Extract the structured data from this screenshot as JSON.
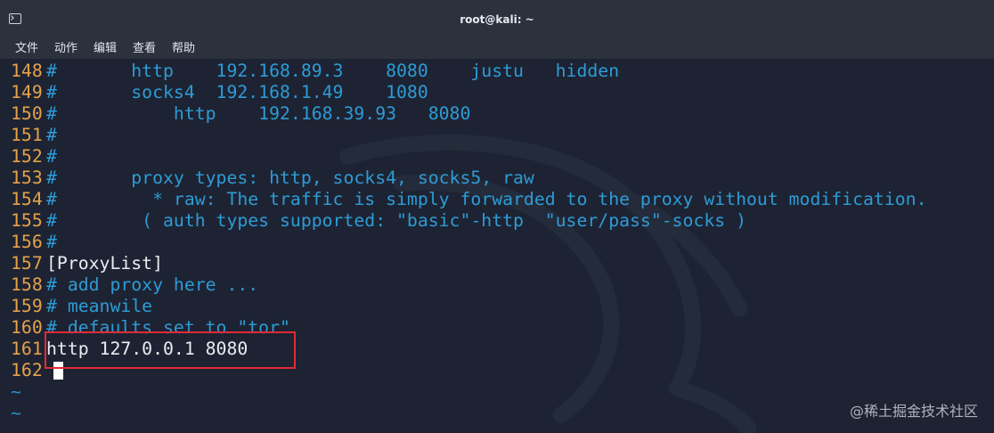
{
  "window": {
    "title": "root@kali: ~"
  },
  "menu": [
    {
      "label": "文件"
    },
    {
      "label": "动作"
    },
    {
      "label": "编辑"
    },
    {
      "label": "查看"
    },
    {
      "label": "帮助"
    }
  ],
  "lines": [
    {
      "num": "148",
      "text": "#       http    192.168.89.3    8080    justu   hidden",
      "style": "comment"
    },
    {
      "num": "149",
      "text": "#       socks4  192.168.1.49    1080",
      "style": "comment"
    },
    {
      "num": "150",
      "text": "#           http    192.168.39.93   8080",
      "style": "comment"
    },
    {
      "num": "151",
      "text": "#",
      "style": "comment"
    },
    {
      "num": "152",
      "text": "#",
      "style": "comment"
    },
    {
      "num": "153",
      "text": "#       proxy types: http, socks4, socks5, raw",
      "style": "comment"
    },
    {
      "num": "154",
      "text": "#         * raw: The traffic is simply forwarded to the proxy without modification.",
      "style": "comment"
    },
    {
      "num": "155",
      "text": "#        ( auth types supported: \"basic\"-http  \"user/pass\"-socks )",
      "style": "comment"
    },
    {
      "num": "156",
      "text": "#",
      "style": "comment"
    },
    {
      "num": "157",
      "text": "[ProxyList]",
      "style": "text"
    },
    {
      "num": "158",
      "text": "# add proxy here ...",
      "style": "comment"
    },
    {
      "num": "159",
      "text": "# meanwile",
      "style": "comment"
    },
    {
      "num": "160",
      "text": "# defaults set to \"tor\"",
      "style": "comment"
    },
    {
      "num": "161",
      "text": "http 127.0.0.1 8080",
      "style": "text"
    },
    {
      "num": "162",
      "text": "",
      "style": "text"
    }
  ],
  "tildes": [
    "~",
    "~"
  ],
  "credit": "@稀土掘金技术社区",
  "colors": {
    "line_number": "#e6a24a",
    "comment": "#2e9bd6",
    "text": "#e9ecf1",
    "highlight": "#e02b36",
    "background": "#1d2332"
  },
  "icons": {
    "app": "terminal-icon"
  }
}
